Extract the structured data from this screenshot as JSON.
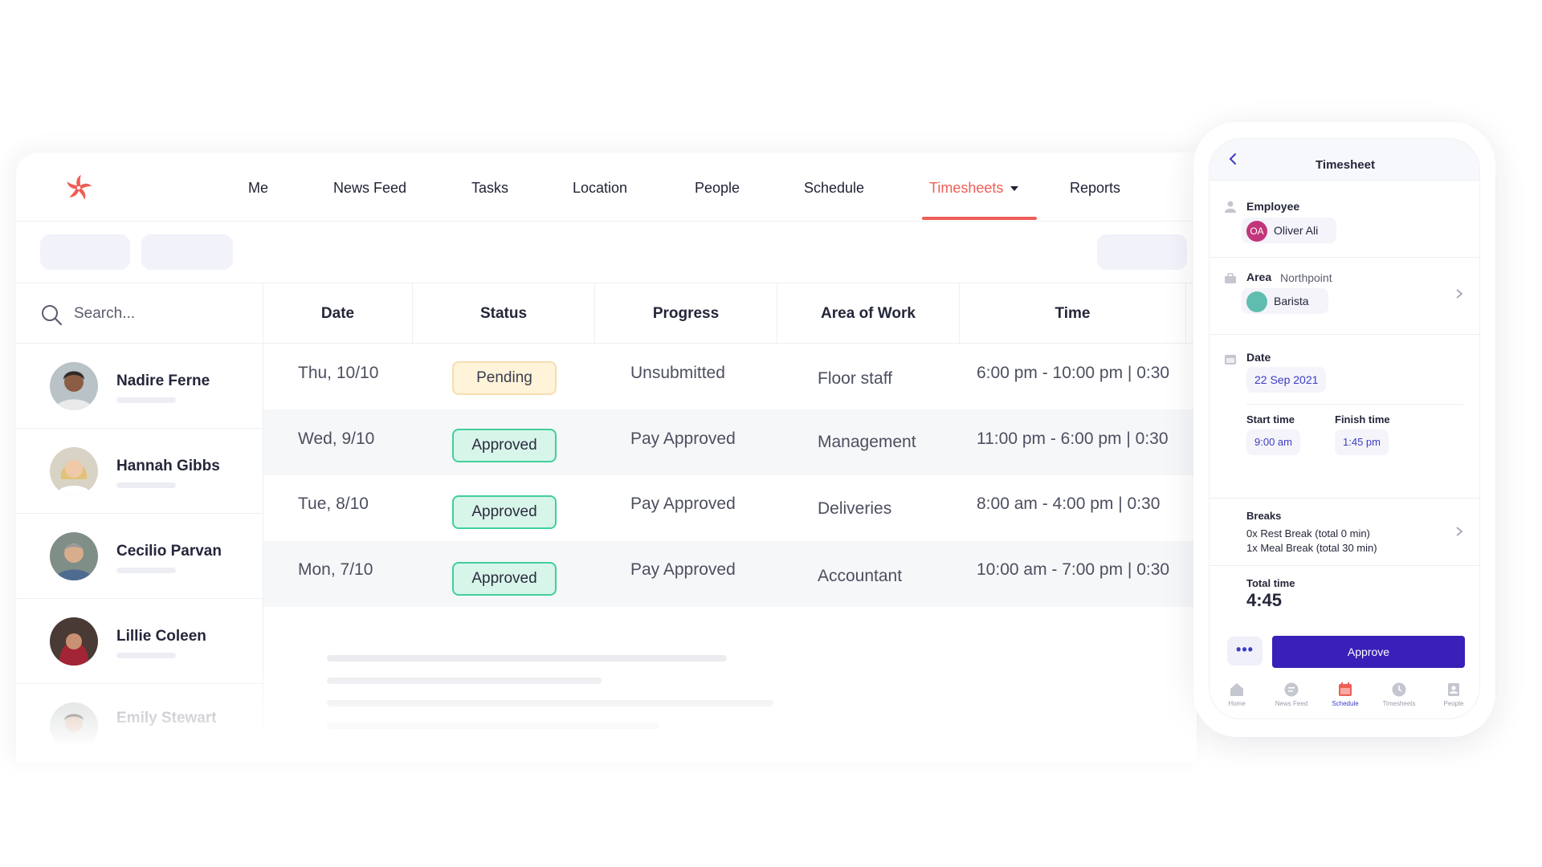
{
  "colors": {
    "accent": "#ee5e56",
    "primary": "#3a1fb8",
    "approved_border": "#40cf9b",
    "pending_bg": "#fff4d9"
  },
  "nav": {
    "logo_icon": "asterisk-logo-icon",
    "items": [
      "Me",
      "News Feed",
      "Tasks",
      "Location",
      "People",
      "Schedule",
      "Timesheets",
      "Reports"
    ],
    "active": "Timesheets"
  },
  "search": {
    "placeholder": "Search..."
  },
  "people": [
    "Nadire Ferne",
    "Hannah Gibbs",
    "Cecilio Parvan",
    "Lillie Coleen",
    "Emily Stewart"
  ],
  "table": {
    "headers": [
      "Date",
      "Status",
      "Progress",
      "Area of Work",
      "Time"
    ],
    "rows": [
      {
        "date": "Thu, 10/10",
        "status": "Pending",
        "progress": "Unsubmitted",
        "area": "Floor staff",
        "time": "6:00 pm - 10:00 pm | 0:30"
      },
      {
        "date": "Wed, 9/10",
        "status": "Approved",
        "progress": "Pay Approved",
        "area": "Management",
        "time": "11:00 pm - 6:00 pm | 0:30"
      },
      {
        "date": "Tue, 8/10",
        "status": "Approved",
        "progress": "Pay Approved",
        "area": "Deliveries",
        "time": "8:00 am - 4:00 pm | 0:30"
      },
      {
        "date": "Mon, 7/10",
        "status": "Approved",
        "progress": "Pay Approved",
        "area": "Accountant",
        "time": "10:00 am - 7:00 pm | 0:30"
      }
    ]
  },
  "phone": {
    "title": "Timesheet",
    "employee_label": "Employee",
    "employee_initials": "OA",
    "employee_name": "Oliver Ali",
    "area_label": "Area",
    "area_location": "Northpoint",
    "area_role": "Barista",
    "date_label": "Date",
    "date_value": "22 Sep 2021",
    "start_label": "Start time",
    "start_value": "9:00 am",
    "finish_label": "Finish time",
    "finish_value": "1:45 pm",
    "breaks_label": "Breaks",
    "break_rest": "0x Rest Break (total 0 min)",
    "break_meal": "1x Meal Break (total 30 min)",
    "total_label": "Total time",
    "total_value": "4:45",
    "more_label": "•••",
    "approve_label": "Approve",
    "tabs": [
      "Home",
      "News Feed",
      "Schedule",
      "Timesheets",
      "People"
    ],
    "active_tab": "Schedule"
  }
}
